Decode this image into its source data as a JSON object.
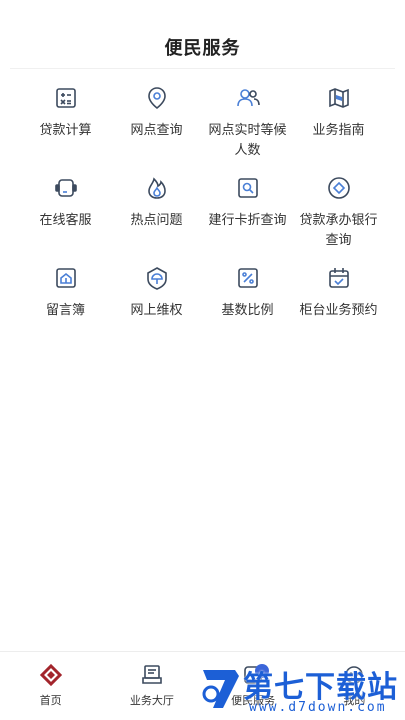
{
  "header": {
    "title": "便民服务"
  },
  "services": [
    {
      "label": "贷款计算",
      "icon": "calculator-icon"
    },
    {
      "label": "网点查询",
      "icon": "location-pin-icon"
    },
    {
      "label": "网点实时等候人数",
      "icon": "people-icon"
    },
    {
      "label": "业务指南",
      "icon": "map-icon"
    },
    {
      "label": "在线客服",
      "icon": "headset-icon"
    },
    {
      "label": "热点问题",
      "icon": "flame-icon"
    },
    {
      "label": "建行卡折查询",
      "icon": "card-search-icon"
    },
    {
      "label": "贷款承办银行查询",
      "icon": "bank-search-icon"
    },
    {
      "label": "留言簿",
      "icon": "message-book-icon"
    },
    {
      "label": "网上维权",
      "icon": "shield-umbrella-icon"
    },
    {
      "label": "基数比例",
      "icon": "percent-icon"
    },
    {
      "label": "柜台业务预约",
      "icon": "calendar-check-icon"
    }
  ],
  "tabbar": {
    "items": [
      {
        "label": "首页",
        "icon": "home-logo-icon"
      },
      {
        "label": "业务大厅",
        "icon": "hall-icon"
      },
      {
        "label": "便民服务",
        "icon": "service-icon"
      },
      {
        "label": "我的",
        "icon": "profile-icon"
      }
    ]
  },
  "watermark": {
    "text": "第七下载站",
    "url": "www.d7down.com"
  },
  "colors": {
    "icon": "#3c4a5e",
    "accent": "#4a7fd6",
    "brand_red": "#a3252c"
  }
}
